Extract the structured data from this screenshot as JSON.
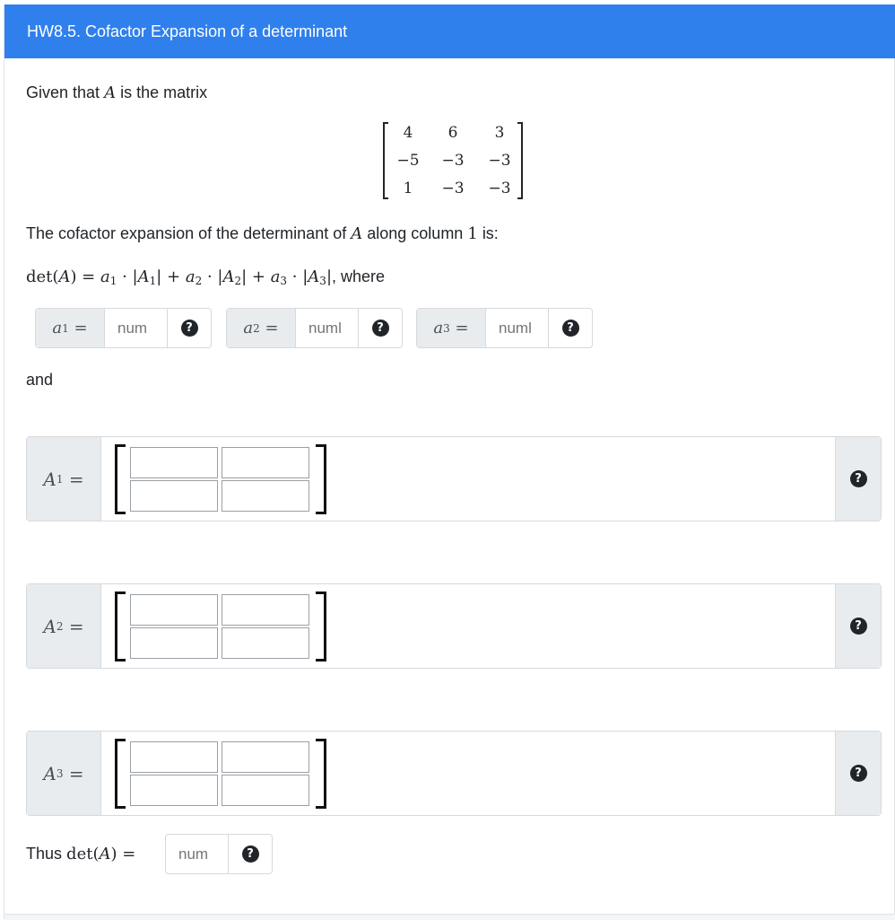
{
  "header": {
    "title": "HW8.5. Cofactor Expansion of a determinant"
  },
  "intro": {
    "text": "Given that",
    "var": "A",
    "suffix": "is the matrix"
  },
  "matrix_A": {
    "rows": [
      [
        "4",
        "6",
        "3"
      ],
      [
        "−5",
        "−3",
        "−3"
      ],
      [
        "1",
        "−3",
        "−3"
      ]
    ]
  },
  "expansion": {
    "prefix": "The cofactor expansion of the determinant of",
    "var": "A",
    "middle": "along column",
    "column": "1",
    "suffix": "is:"
  },
  "formula": {
    "det": "det(",
    "A": "A",
    "eq": ") = ",
    "terms": [
      {
        "coef": "a",
        "idx": "1",
        "minor": "A",
        "minor_idx": "1"
      },
      {
        "coef": "a",
        "idx": "2",
        "minor": "A",
        "minor_idx": "2"
      },
      {
        "coef": "a",
        "idx": "3",
        "minor": "A",
        "minor_idx": "3"
      }
    ],
    "suffix": ", where"
  },
  "coef_inputs": [
    {
      "label": "a",
      "idx": "1",
      "placeholder": "num"
    },
    {
      "label": "a",
      "idx": "2",
      "placeholder": "numl"
    },
    {
      "label": "a",
      "idx": "3",
      "placeholder": "numl"
    }
  ],
  "and_text": "and",
  "minor_inputs": [
    {
      "label": "A",
      "idx": "1"
    },
    {
      "label": "A",
      "idx": "2"
    },
    {
      "label": "A",
      "idx": "3"
    }
  ],
  "final": {
    "prefix": "Thus",
    "det": "det(",
    "A": "A",
    "close": ") =",
    "placeholder": "num"
  },
  "help_icon": {
    "glyph": "?",
    "name": "question-circle-icon"
  },
  "colors": {
    "header_bg": "#2f80ed",
    "addon_bg": "#e9ecef",
    "border": "#d6d9dd"
  }
}
